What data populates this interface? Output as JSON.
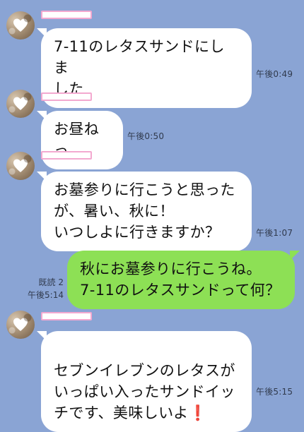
{
  "messages": [
    {
      "side": "left",
      "text": "7-11のレタスサンドにしま\nした",
      "time": "午後0:49"
    },
    {
      "side": "left",
      "text": "お昼ねっ",
      "time": "午後0:50"
    },
    {
      "side": "left",
      "text": "お墓参りに行こうと思った\nが、暑い、秋に！\nいつしよに行きますか？",
      "time": "午後1:07"
    },
    {
      "side": "right",
      "text": "秋にお墓参りに行こうね。\n7-11のレタスサンドって何？",
      "read": "既読 2",
      "time": "午後5:14"
    },
    {
      "side": "left",
      "text_main": "セブンイレブンのレタスが\nいっぱい入ったサンドイッ\nチです、美味しいよ",
      "text_emoji": "❗",
      "time": "午後5:15"
    }
  ],
  "colors": {
    "background": "#8aa4d4",
    "incoming_bubble": "#ffffff",
    "outgoing_bubble": "#8de055",
    "name_redaction_border": "#f3a9d0",
    "avatar_heart": "#ffffff",
    "exclamation": "#e0152e"
  },
  "icons": {
    "avatar": "heart-avatar-icon"
  }
}
